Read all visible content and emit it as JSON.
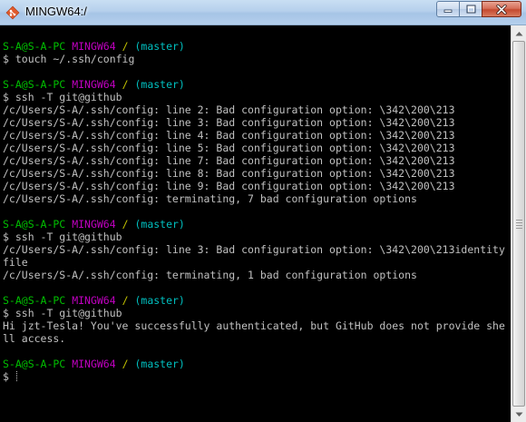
{
  "window": {
    "title": "MINGW64:/"
  },
  "prompt": {
    "user": "S-A@S-A-PC",
    "host": "MINGW64",
    "path": "/",
    "branch": "(master)",
    "symbol": "$"
  },
  "lines": {
    "l1": "$ touch ~/.ssh/config",
    "l2": "$ ssh -T git@github",
    "l3": "/c/Users/S-A/.ssh/config: line 2: Bad configuration option: \\342\\200\\213",
    "l4": "/c/Users/S-A/.ssh/config: line 3: Bad configuration option: \\342\\200\\213",
    "l5": "/c/Users/S-A/.ssh/config: line 4: Bad configuration option: \\342\\200\\213",
    "l6": "/c/Users/S-A/.ssh/config: line 5: Bad configuration option: \\342\\200\\213",
    "l7": "/c/Users/S-A/.ssh/config: line 7: Bad configuration option: \\342\\200\\213",
    "l8": "/c/Users/S-A/.ssh/config: line 8: Bad configuration option: \\342\\200\\213",
    "l9": "/c/Users/S-A/.ssh/config: line 9: Bad configuration option: \\342\\200\\213",
    "l10": "/c/Users/S-A/.ssh/config: terminating, 7 bad configuration options",
    "l11": "$ ssh -T git@github",
    "l12": "/c/Users/S-A/.ssh/config: line 3: Bad configuration option: \\342\\200\\213identity",
    "l13": "file",
    "l14": "/c/Users/S-A/.ssh/config: terminating, 1 bad configuration options",
    "l15": "$ ssh -T git@github",
    "l16": "Hi jzt-Tesla! You've successfully authenticated, but GitHub does not provide she",
    "l17": "ll access."
  },
  "colors": {
    "user": "#00c000",
    "host": "#c000c0",
    "path": "#c0c000",
    "branch": "#00c0c0",
    "text": "#c0c0c0",
    "background": "#000000"
  },
  "icons": {
    "app": "git-bash-icon",
    "minimize": "minimize-icon",
    "maximize": "maximize-icon",
    "close": "close-icon"
  }
}
